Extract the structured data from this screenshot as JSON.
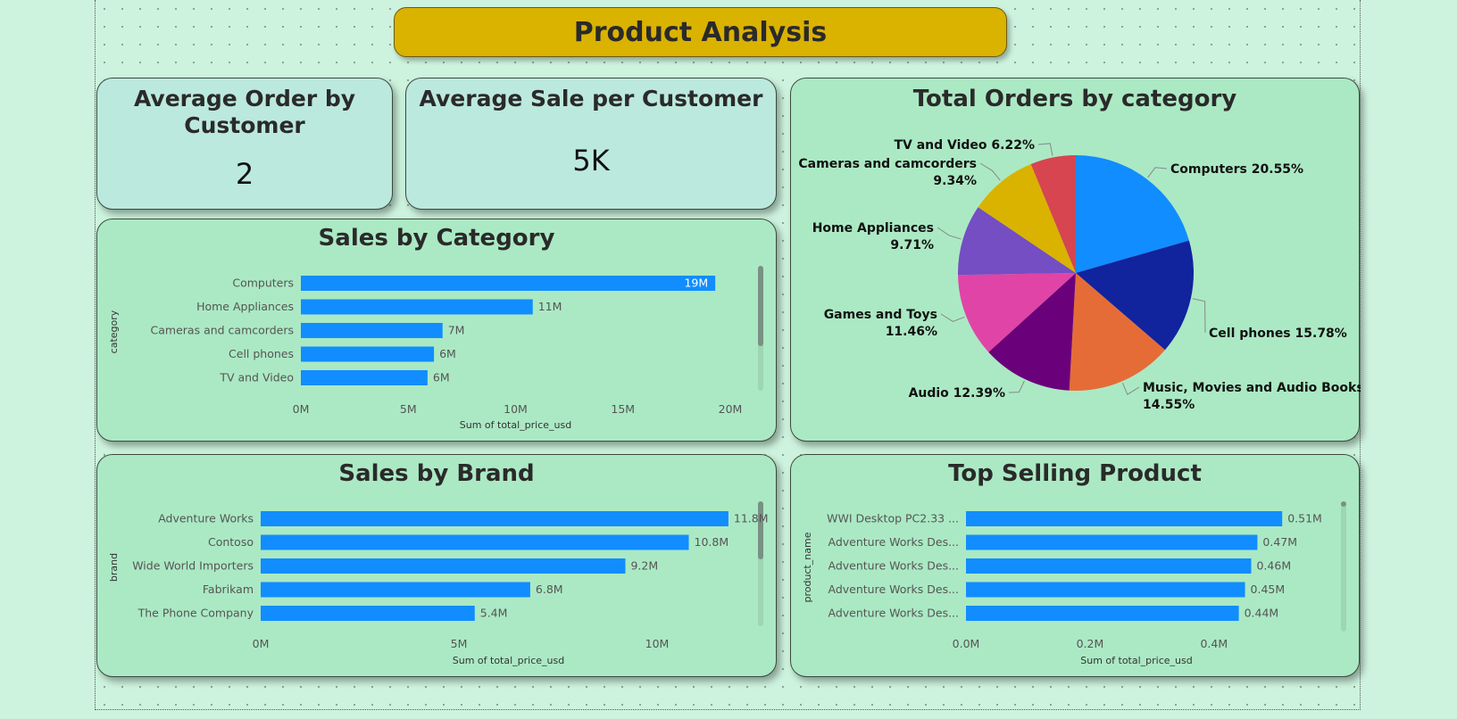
{
  "page": {
    "title": "Product Analysis"
  },
  "kpis": [
    {
      "title_line1": "Average Order by",
      "title_line2": "Customer",
      "value": "2"
    },
    {
      "title_line1": "Average Sale per Customer",
      "value": "5K"
    }
  ],
  "colors": {
    "bar": "#118dff",
    "banner": "#dab200",
    "kpi_bg": "#bce9dd",
    "panel_bg": "#abe9c4"
  },
  "chart_data": [
    {
      "id": "sales-by-category",
      "type": "bar",
      "orientation": "horizontal",
      "title": "Sales by Category",
      "xlabel": "Sum of total_price_usd",
      "ylabel": "category",
      "categories": [
        "Computers",
        "Home Appliances",
        "Cameras and camcorders",
        "Cell phones",
        "TV and Video"
      ],
      "values": [
        19.3,
        10.8,
        6.6,
        6.2,
        5.9
      ],
      "data_labels": [
        "19M",
        "11M",
        "7M",
        "6M",
        "6M"
      ],
      "xlim": [
        0,
        20
      ],
      "ticks": [
        "0M",
        "5M",
        "10M",
        "15M",
        "20M"
      ],
      "tick_values": [
        0,
        5,
        10,
        15,
        20
      ],
      "grid": false
    },
    {
      "id": "total-orders-by-category",
      "type": "pie",
      "title": "Total Orders by category",
      "slices": [
        {
          "label": "Computers",
          "percent": 20.55,
          "display": "Computers 20.55%",
          "color": "#118dff"
        },
        {
          "label": "Cell phones",
          "percent": 15.78,
          "display": "Cell phones 15.78%",
          "color": "#12239e"
        },
        {
          "label": "Music, Movies and Audio Books",
          "percent": 14.55,
          "display_line1": "Music, Movies and Audio Books",
          "display_line2": "14.55%",
          "color": "#e66c37"
        },
        {
          "label": "Audio",
          "percent": 12.39,
          "display": "Audio 12.39%",
          "color": "#6b007b"
        },
        {
          "label": "Games and Toys",
          "percent": 11.46,
          "display_line1": "Games and Toys",
          "display_line2": "11.46%",
          "color": "#e044a7"
        },
        {
          "label": "Home Appliances",
          "percent": 9.71,
          "display_line1": "Home Appliances",
          "display_line2": "9.71%",
          "color": "#744ec2"
        },
        {
          "label": "Cameras and camcorders",
          "percent": 9.34,
          "display_line1": "Cameras and camcorders",
          "display_line2": "9.34%",
          "color": "#d9b300"
        },
        {
          "label": "TV and Video",
          "percent": 6.22,
          "display": "TV and Video 6.22%",
          "color": "#d64550"
        }
      ]
    },
    {
      "id": "sales-by-brand",
      "type": "bar",
      "orientation": "horizontal",
      "title": "Sales by Brand",
      "xlabel": "Sum of total_price_usd",
      "ylabel": "brand",
      "categories": [
        "Adventure Works",
        "Contoso",
        "Wide World Importers",
        "Fabrikam",
        "The Phone Company"
      ],
      "values": [
        11.8,
        10.8,
        9.2,
        6.8,
        5.4
      ],
      "data_labels": [
        "11.8M",
        "10.8M",
        "9.2M",
        "6.8M",
        "5.4M"
      ],
      "xlim": [
        0,
        12.5
      ],
      "ticks": [
        "0M",
        "5M",
        "10M"
      ],
      "tick_values": [
        0,
        5,
        10
      ],
      "grid": false
    },
    {
      "id": "top-selling-product",
      "type": "bar",
      "orientation": "horizontal",
      "title": "Top Selling Product",
      "xlabel": "Sum of total_price_usd",
      "ylabel": "product_name",
      "categories": [
        "WWI Desktop PC2.33 ...",
        "Adventure Works Des...",
        "Adventure Works Des...",
        "Adventure Works Des...",
        "Adventure Works Des..."
      ],
      "values": [
        0.51,
        0.47,
        0.46,
        0.45,
        0.44
      ],
      "data_labels": [
        "0.51M",
        "0.47M",
        "0.46M",
        "0.45M",
        "0.44M"
      ],
      "xlim": [
        0,
        0.55
      ],
      "ticks": [
        "0.0M",
        "0.2M",
        "0.4M"
      ],
      "tick_values": [
        0,
        0.2,
        0.4
      ],
      "grid": false
    }
  ]
}
